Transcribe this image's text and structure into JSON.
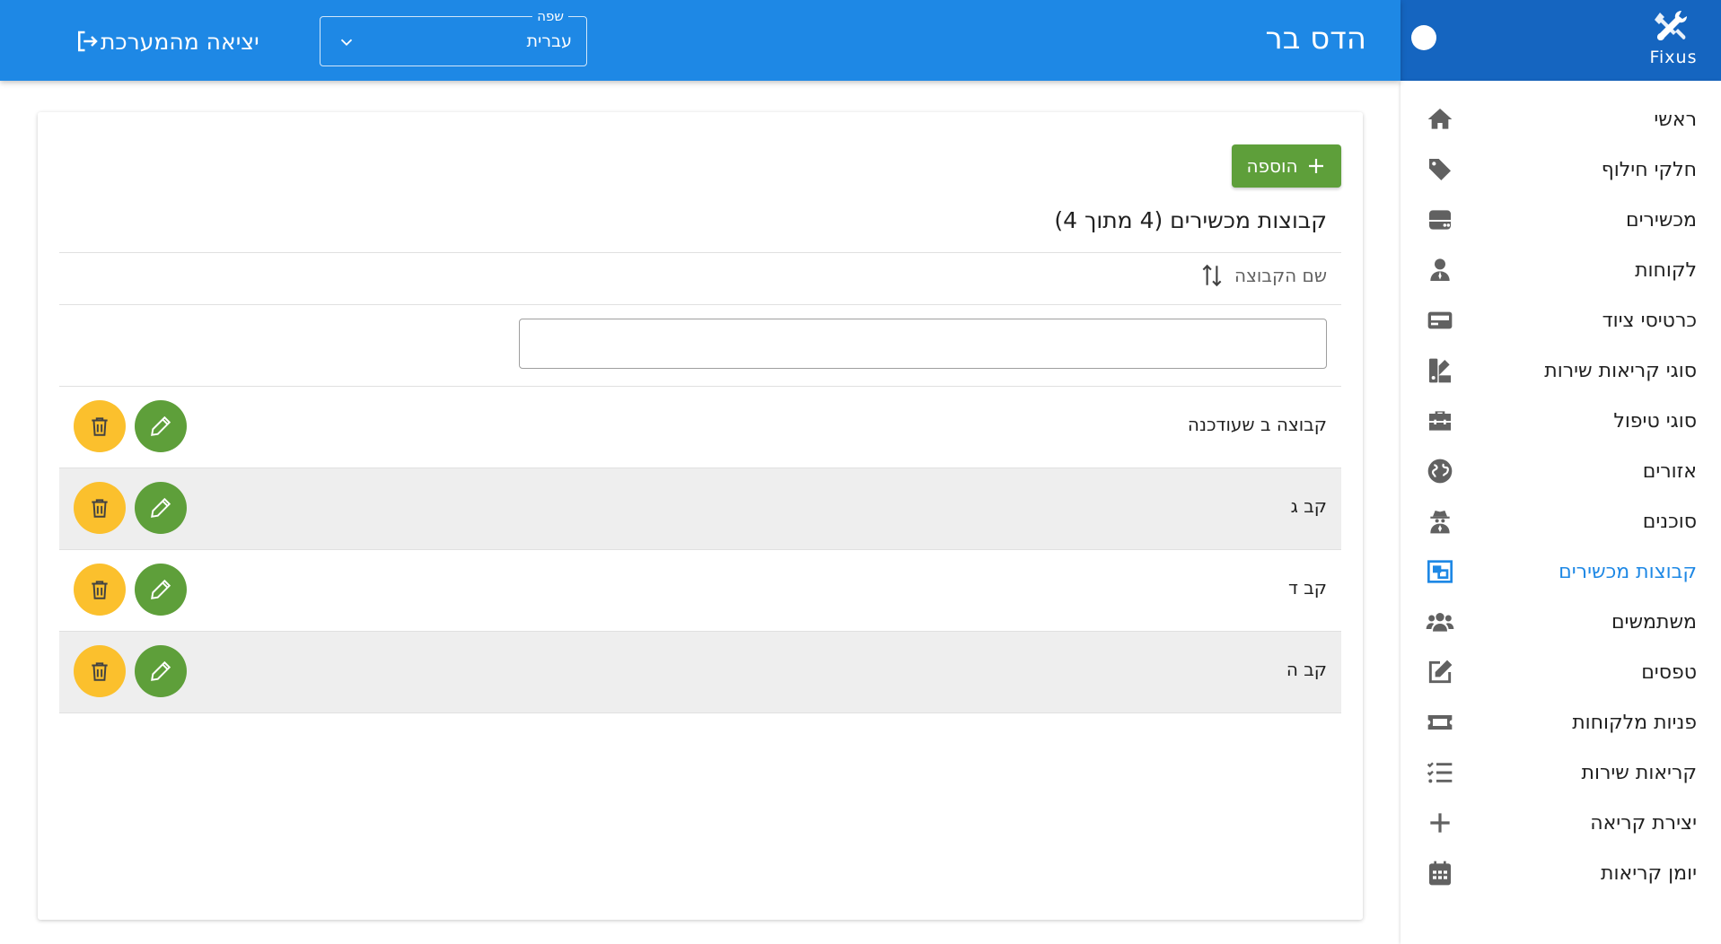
{
  "header": {
    "user_name": "הדס בר",
    "language": {
      "legend": "שפה",
      "value": "עברית"
    },
    "logout_label": "יציאה מהמערכת"
  },
  "brand": {
    "name": "Fixus"
  },
  "sidebar": {
    "items": [
      {
        "label": "ראשי",
        "icon": "home-icon"
      },
      {
        "label": "חלקי חילוף",
        "icon": "tags-icon"
      },
      {
        "label": "מכשירים",
        "icon": "hdd-icon"
      },
      {
        "label": "לקוחות",
        "icon": "user-tie-icon"
      },
      {
        "label": "כרטיסי ציוד",
        "icon": "card-icon"
      },
      {
        "label": "סוגי קריאות שירות",
        "icon": "swatchbook-icon"
      },
      {
        "label": "סוגי טיפול",
        "icon": "toolbox-icon"
      },
      {
        "label": "אזורים",
        "icon": "globe-icon"
      },
      {
        "label": "סוכנים",
        "icon": "user-secret-icon"
      },
      {
        "label": "קבוצות מכשירים",
        "icon": "object-group-icon",
        "active": true
      },
      {
        "label": "משתמשים",
        "icon": "users-icon"
      },
      {
        "label": "טפסים",
        "icon": "edit-icon"
      },
      {
        "label": "פניות מלקוחות",
        "icon": "ticket-icon"
      },
      {
        "label": "קריאות שירות",
        "icon": "tasks-icon"
      },
      {
        "label": "יצירת קריאה",
        "icon": "plus-icon"
      },
      {
        "label": "יומן קריאות",
        "icon": "calendar-icon"
      }
    ]
  },
  "main": {
    "add_label": "הוספה",
    "title": "קבוצות מכשירים (4 מתוך 4)",
    "column_header": "שם הקבוצה",
    "filter_value": "",
    "rows": [
      {
        "name": "קבוצה ב שעודכנה"
      },
      {
        "name": "קב ג"
      },
      {
        "name": "קב ד"
      },
      {
        "name": "קב ה"
      }
    ]
  },
  "colors": {
    "primary": "#1e88e5",
    "sidebar_header": "#1565c0",
    "success": "#5e9f3a",
    "warning": "#fbc02d"
  }
}
